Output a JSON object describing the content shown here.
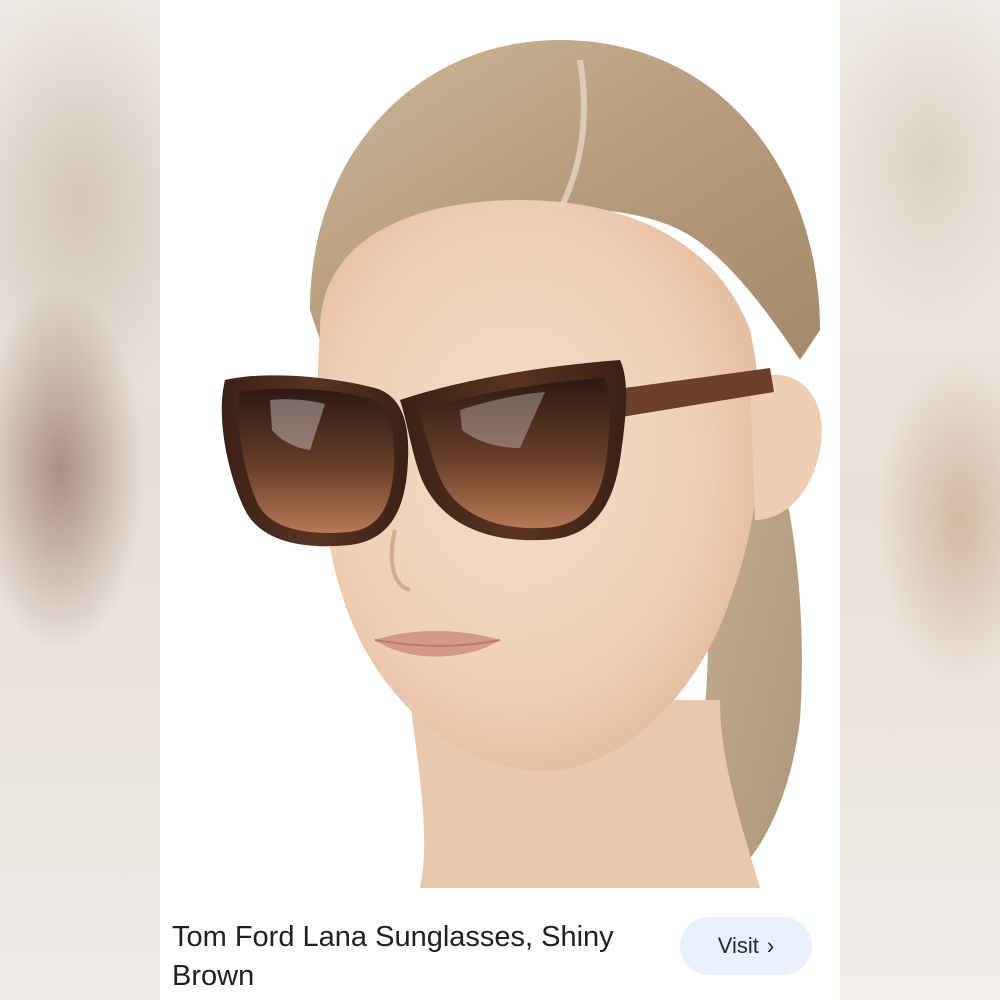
{
  "product": {
    "title": "Tom Ford Lana Sunglasses, Shiny Brown"
  },
  "actions": {
    "visit_label": "Visit",
    "visit_icon": "chevron-right-icon"
  },
  "colors": {
    "button_bg": "#e8f0fe",
    "title_text": "#202124"
  }
}
